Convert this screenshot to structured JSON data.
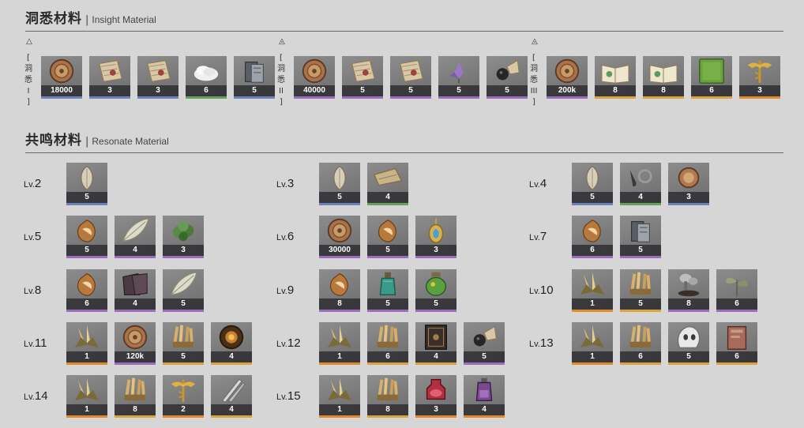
{
  "insight": {
    "title_zh": "洞悉材料",
    "title_en": "Insight Material",
    "groups": [
      {
        "triangle": "△",
        "label_chars": [
          "[",
          "洞",
          "悉",
          "I",
          "]"
        ],
        "items": [
          {
            "icon": "coin",
            "count": "18000",
            "rarity": "blue"
          },
          {
            "icon": "map",
            "count": "3",
            "rarity": "blue"
          },
          {
            "icon": "map",
            "count": "3",
            "rarity": "blue"
          },
          {
            "icon": "powder",
            "count": "6",
            "rarity": "green"
          },
          {
            "icon": "plates",
            "count": "5",
            "rarity": "blue"
          }
        ]
      },
      {
        "triangle": "◬",
        "label_chars": [
          "[",
          "洞",
          "悉",
          "II",
          "]"
        ],
        "items": [
          {
            "icon": "coin",
            "count": "40000",
            "rarity": "purple"
          },
          {
            "icon": "map",
            "count": "5",
            "rarity": "purple"
          },
          {
            "icon": "map",
            "count": "5",
            "rarity": "purple"
          },
          {
            "icon": "flower",
            "count": "5",
            "rarity": "purple"
          },
          {
            "icon": "bomb",
            "count": "5",
            "rarity": "purple"
          }
        ]
      },
      {
        "triangle": "◬",
        "label_chars": [
          "[",
          "洞",
          "悉",
          "III",
          "]"
        ],
        "items": [
          {
            "icon": "coin",
            "count": "200k",
            "rarity": "purple"
          },
          {
            "icon": "book",
            "count": "8",
            "rarity": "gold"
          },
          {
            "icon": "book",
            "count": "8",
            "rarity": "gold"
          },
          {
            "icon": "greenbook",
            "count": "6",
            "rarity": "gold"
          },
          {
            "icon": "caduceus",
            "count": "3",
            "rarity": "orange"
          }
        ]
      }
    ]
  },
  "resonate": {
    "title_zh": "共鸣材料",
    "title_en": "Resonate Material",
    "lv_prefix": "Lv.",
    "levels": [
      {
        "lv": "2",
        "items": [
          {
            "icon": "shell",
            "count": "5",
            "rarity": "blue"
          }
        ]
      },
      {
        "lv": "3",
        "items": [
          {
            "icon": "shell",
            "count": "5",
            "rarity": "blue"
          },
          {
            "icon": "cloth",
            "count": "4",
            "rarity": "green"
          }
        ]
      },
      {
        "lv": "4",
        "items": [
          {
            "icon": "shell",
            "count": "5",
            "rarity": "blue"
          },
          {
            "icon": "tools",
            "count": "4",
            "rarity": "green"
          },
          {
            "icon": "coinsmall",
            "count": "3",
            "rarity": "blue"
          }
        ]
      },
      {
        "lv": "5",
        "items": [
          {
            "icon": "nut",
            "count": "5",
            "rarity": "purple"
          },
          {
            "icon": "feather",
            "count": "4",
            "rarity": "purple"
          },
          {
            "icon": "moss",
            "count": "3",
            "rarity": "purple"
          }
        ]
      },
      {
        "lv": "6",
        "items": [
          {
            "icon": "coin",
            "count": "30000",
            "rarity": "purple"
          },
          {
            "icon": "nut",
            "count": "5",
            "rarity": "purple"
          },
          {
            "icon": "amulet",
            "count": "3",
            "rarity": "purple"
          }
        ]
      },
      {
        "lv": "7",
        "items": [
          {
            "icon": "nut",
            "count": "6",
            "rarity": "purple"
          },
          {
            "icon": "plates",
            "count": "5",
            "rarity": "purple"
          }
        ]
      },
      {
        "lv": "8",
        "items": [
          {
            "icon": "nut",
            "count": "6",
            "rarity": "purple"
          },
          {
            "icon": "darkcloth",
            "count": "4",
            "rarity": "purple"
          },
          {
            "icon": "feather",
            "count": "5",
            "rarity": "purple"
          }
        ]
      },
      {
        "lv": "9",
        "items": [
          {
            "icon": "nut",
            "count": "8",
            "rarity": "purple"
          },
          {
            "icon": "bottle",
            "count": "5",
            "rarity": "purple"
          },
          {
            "icon": "jar",
            "count": "5",
            "rarity": "purple"
          }
        ]
      },
      {
        "lv": "10",
        "items": [
          {
            "icon": "crystal",
            "count": "1",
            "rarity": "orange"
          },
          {
            "icon": "sticks",
            "count": "5",
            "rarity": "gold"
          },
          {
            "icon": "fungus",
            "count": "8",
            "rarity": "purple"
          },
          {
            "icon": "plant",
            "count": "6",
            "rarity": "purple"
          }
        ]
      },
      {
        "lv": "11",
        "items": [
          {
            "icon": "crystal",
            "count": "1",
            "rarity": "orange"
          },
          {
            "icon": "coin",
            "count": "120k",
            "rarity": "purple"
          },
          {
            "icon": "sticks",
            "count": "5",
            "rarity": "gold"
          },
          {
            "icon": "wreath",
            "count": "4",
            "rarity": "gold"
          }
        ]
      },
      {
        "lv": "12",
        "items": [
          {
            "icon": "crystal",
            "count": "1",
            "rarity": "orange"
          },
          {
            "icon": "sticks",
            "count": "6",
            "rarity": "gold"
          },
          {
            "icon": "tome",
            "count": "4",
            "rarity": "gold"
          },
          {
            "icon": "bomb",
            "count": "5",
            "rarity": "purple"
          }
        ]
      },
      {
        "lv": "13",
        "items": [
          {
            "icon": "crystal",
            "count": "1",
            "rarity": "orange"
          },
          {
            "icon": "sticks",
            "count": "6",
            "rarity": "gold"
          },
          {
            "icon": "skull",
            "count": "5",
            "rarity": "gold"
          },
          {
            "icon": "scroll",
            "count": "6",
            "rarity": "gold"
          }
        ]
      },
      {
        "lv": "14",
        "items": [
          {
            "icon": "crystal",
            "count": "1",
            "rarity": "orange"
          },
          {
            "icon": "sticks",
            "count": "8",
            "rarity": "gold"
          },
          {
            "icon": "caduceus",
            "count": "2",
            "rarity": "orange"
          },
          {
            "icon": "blades",
            "count": "4",
            "rarity": "gold"
          }
        ]
      },
      {
        "lv": "15",
        "items": [
          {
            "icon": "crystal",
            "count": "1",
            "rarity": "orange"
          },
          {
            "icon": "sticks",
            "count": "8",
            "rarity": "gold"
          },
          {
            "icon": "potion",
            "count": "3",
            "rarity": "orange"
          },
          {
            "icon": "vial",
            "count": "4",
            "rarity": "orange"
          }
        ]
      }
    ]
  }
}
